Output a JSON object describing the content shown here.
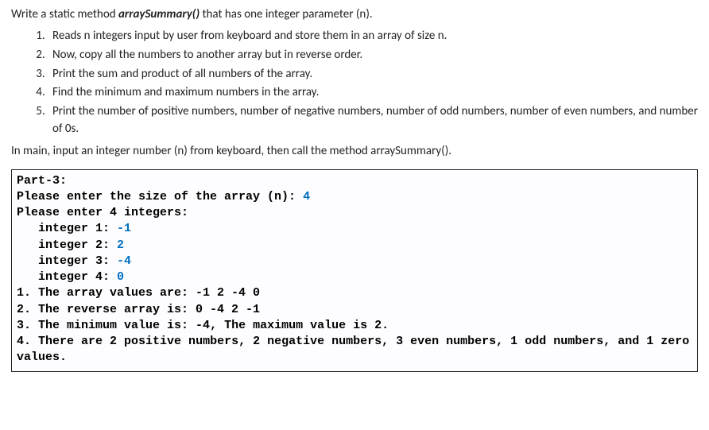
{
  "intro_pre": "Write a static method ",
  "intro_method": "arraySummary()",
  "intro_post": " that has one integer parameter (n).",
  "tasks": [
    "Reads n integers input by user from keyboard and store them in an array of size n.",
    "Now, copy all the numbers to another array but in reverse order.",
    "Print the sum and product of all numbers of the array.",
    "Find the minimum and maximum numbers in the array.",
    "Print the number of positive numbers, number of negative numbers, number of odd numbers, number of even numbers, and number of 0s."
  ],
  "post": "In main, input an integer number (n) from keyboard, then call the method arraySummary().",
  "console": {
    "part_label": "Part-3:",
    "size_prompt": "Please enter the size of the array (n): ",
    "size_value": "4",
    "enter_ints_pre": "Please enter ",
    "enter_ints_n": "4",
    "enter_ints_post": " integers:",
    "inputs": [
      {
        "label": "   integer 1: ",
        "value": "-1"
      },
      {
        "label": "   integer 2: ",
        "value": "2"
      },
      {
        "label": "   integer 3: ",
        "value": "-4"
      },
      {
        "label": "   integer 4: ",
        "value": "0"
      }
    ],
    "out1_label": "1. The array values are: ",
    "out1_vals": "-1 2 -4 0",
    "out2_label": "2. The reverse array is: ",
    "out2_vals": "0 -4 2 -1",
    "out3_a": "3. The minimum value is: ",
    "out3_min": "-4",
    "out3_b": ", The maximum value is ",
    "out3_max": "2",
    "out3_c": ".",
    "out4_a": "4. There are ",
    "out4_pos": "2",
    "out4_b": " positive numbers, ",
    "out4_neg": "2",
    "out4_c": " negative numbers, ",
    "out4_even": "3",
    "out4_d": " even numbers, ",
    "out4_odd": "1",
    "out4_e": " odd numbers, and ",
    "out4_zero": "1",
    "out4_f": " zero values."
  }
}
